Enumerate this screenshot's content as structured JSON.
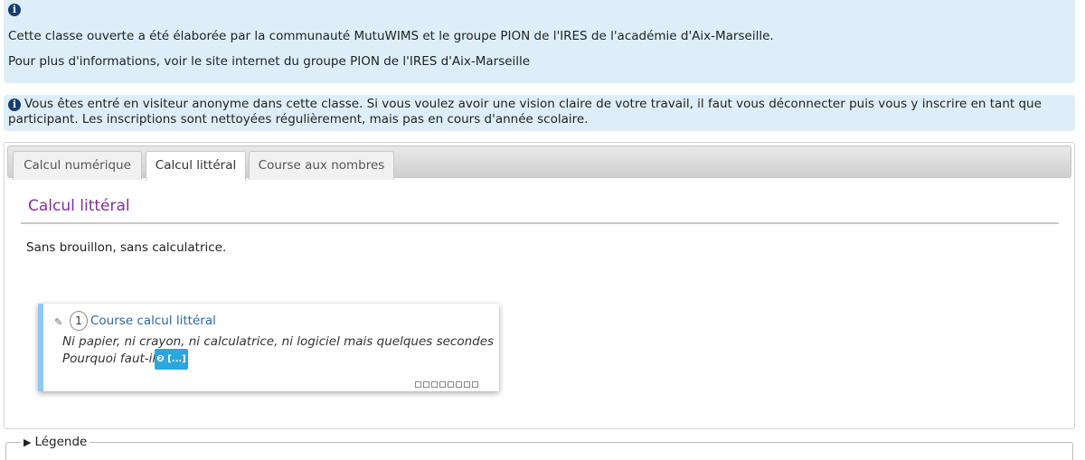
{
  "info": {
    "icon": "info-icon",
    "icon_glyph": "i",
    "line1": "Cette classe ouverte a été élaborée par la communauté MutuWIMS et le groupe PION de l'IRES de l'académie d'Aix-Marseille.",
    "line2": "Pour plus d'informations, voir le site internet du groupe PION de l'IRES d'Aix-Marseille"
  },
  "notice": {
    "icon": "info-icon",
    "icon_glyph": "i",
    "text": "Vous êtes entré en visiteur anonyme dans cette classe. Si vous voulez avoir une vision claire de votre travail, il faut vous déconnecter puis vous y inscrire en tant que participant. Les inscriptions sont nettoyées régulièrement, mais pas en cours d'année scolaire."
  },
  "tabs": [
    {
      "label": "Calcul numérique",
      "active": false
    },
    {
      "label": "Calcul littéral",
      "active": true
    },
    {
      "label": "Course aux nombres",
      "active": false
    }
  ],
  "section": {
    "title": "Calcul littéral",
    "description": "Sans brouillon, sans calculatrice."
  },
  "card": {
    "pencil_glyph": "✎",
    "number": "1",
    "link": "Course calcul littéral",
    "desc1": "Ni papier, ni crayon, ni calculatrice, ni logiciel mais quelques secondes",
    "desc2": "Pourquoi faut-il",
    "more_label": "❷ [...]",
    "progress_total": 8,
    "progress_done": 0
  },
  "legend": {
    "arrow": "▶",
    "label": "Légende"
  },
  "colors": {
    "info_bg": "#ddeef9",
    "title_purple": "#80309a",
    "link_blue": "#2868a8",
    "card_accent": "#8ec8f4",
    "more_btn": "#2aa6e0"
  }
}
